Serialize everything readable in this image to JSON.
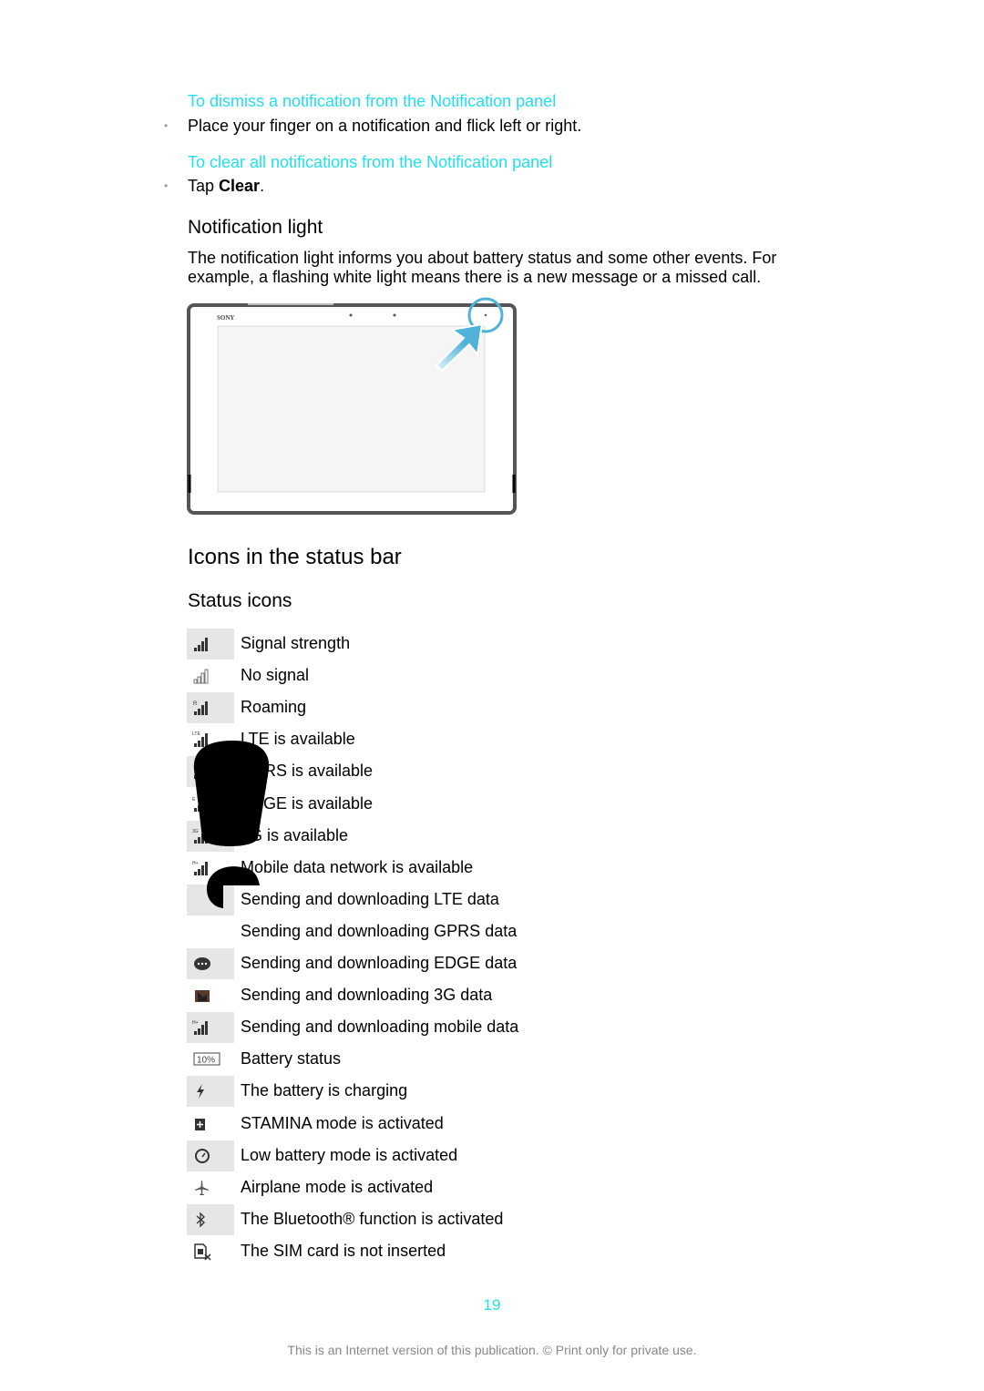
{
  "sections": {
    "dismiss_heading": "To dismiss a notification from the Notification panel",
    "dismiss_step": "Place your finger on a notification and flick left or right.",
    "clear_heading": "To clear all notifications from the Notification panel",
    "clear_step_prefix": "Tap ",
    "clear_step_bold": "Clear",
    "clear_step_suffix": ".",
    "notification_light_title": "Notification light",
    "notification_light_text_1": "The notification light informs you about battery status and some other events. For",
    "notification_light_text_2": "example, a flashing white light means there is a new message or a missed call.",
    "icons_title": "Icons in the status bar",
    "status_icons_title": "Status icons"
  },
  "illustration": {
    "brand": "SONY",
    "accent": "#4fb3d9"
  },
  "status_icons": [
    {
      "icon": "signal-strength-icon",
      "label": "Signal strength"
    },
    {
      "icon": "no-signal-icon",
      "label": "No signal"
    },
    {
      "icon": "roaming-icon",
      "label": "Roaming"
    },
    {
      "icon": "lte-icon",
      "label": "LTE is available"
    },
    {
      "icon": "gprs-icon",
      "label": "GPRS is available"
    },
    {
      "icon": "edge-icon",
      "label": "EDGE is available"
    },
    {
      "icon": "3g-icon",
      "label": "3G is available"
    },
    {
      "icon": "hplus-icon",
      "label": "Mobile data network is available"
    },
    {
      "icon": "lte-data-icon",
      "label": "Sending and downloading LTE data"
    },
    {
      "icon": "gprs-data-icon",
      "label": "Sending and downloading GPRS data"
    },
    {
      "icon": "edge-data-icon",
      "label": "Sending and downloading EDGE data"
    },
    {
      "icon": "3g-data-icon",
      "label": "Sending and downloading 3G data"
    },
    {
      "icon": "mobile-data-icon",
      "label": "Sending and downloading mobile data"
    },
    {
      "icon": "battery-icon",
      "label": "Battery status",
      "icon_text": "10%"
    },
    {
      "icon": "charging-icon",
      "label": "The battery is charging"
    },
    {
      "icon": "stamina-icon",
      "label": "STAMINA mode is activated"
    },
    {
      "icon": "low-battery-mode-icon",
      "label": "Low battery mode is activated"
    },
    {
      "icon": "airplane-icon",
      "label": "Airplane mode is activated"
    },
    {
      "icon": "bluetooth-icon",
      "label": "The Bluetooth® function is activated"
    },
    {
      "icon": "no-sim-icon",
      "label": "The SIM card is not inserted"
    }
  ],
  "footer": {
    "page_number": "19",
    "notice": "This is an Internet version of this publication. © Print only for private use."
  },
  "colors": {
    "heading_accent": "#22e0ef",
    "row_shade": "#e6e6e6"
  }
}
